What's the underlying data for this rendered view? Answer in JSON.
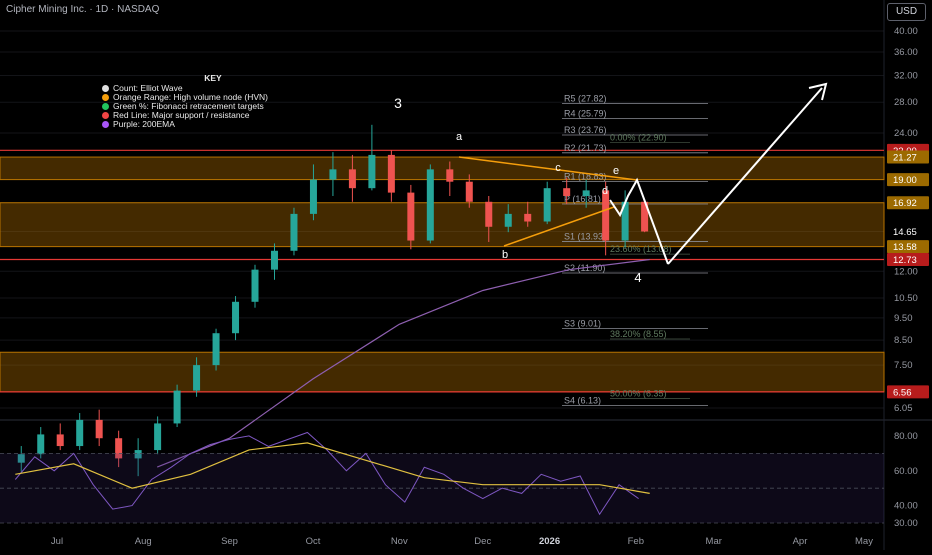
{
  "header": {
    "title": "Cipher Mining Inc. · 1D · NASDAQ",
    "currency": "USD"
  },
  "key": {
    "title": "KEY",
    "items": [
      {
        "label": "Count: Elliot Wave",
        "color": "#e0e0e0"
      },
      {
        "label": "Orange Range: High volume node (HVN)",
        "color": "#f59e0b"
      },
      {
        "label": "Green %: Fibonacci retracement targets",
        "color": "#22c55e"
      },
      {
        "label": "Red Line: Major support / resistance",
        "color": "#ef4444"
      },
      {
        "label": "Purple: 200EMA",
        "color": "#a855f7"
      }
    ]
  },
  "chart_data": [
    {
      "type": "candlestick",
      "y_scale": "log",
      "price_axis_ticks": [
        40.0,
        36.0,
        32.0,
        28.0,
        24.0,
        19.0,
        16.92,
        14.65,
        12.0,
        10.5,
        9.5,
        8.5,
        7.5,
        6.05
      ],
      "price_badges": [
        {
          "value": "22.00",
          "bg": "#b71c1c"
        },
        {
          "value": "21.27",
          "bg": "#9c6a00"
        },
        {
          "value": "19.00",
          "bg": "#9c6a00"
        },
        {
          "value": "16.92",
          "bg": "#9c6a00"
        },
        {
          "value": "14.65",
          "bg": "#000000"
        },
        {
          "value": "13.58",
          "bg": "#9c6a00"
        },
        {
          "value": "12.73",
          "bg": "#b71c1c"
        },
        {
          "value": "6.56",
          "bg": "#b71c1c"
        }
      ],
      "x_axis_labels": [
        "Jul",
        "Aug",
        "Sep",
        "Oct",
        "Nov",
        "Dec",
        "2026",
        "Feb",
        "Mar",
        "Apr",
        "May"
      ],
      "hvn_zones": [
        [
          19.0,
          21.27
        ],
        [
          13.58,
          16.92
        ],
        [
          6.56,
          8.0
        ]
      ],
      "support_resistance_lines": [
        22.0,
        12.73,
        6.56
      ],
      "pivot_levels": [
        {
          "label": "R5 (27.82)",
          "value": 27.82
        },
        {
          "label": "R4 (25.79)",
          "value": 25.79
        },
        {
          "label": "R3 (23.76)",
          "value": 23.76
        },
        {
          "label": "R2 (21.73)",
          "value": 21.73
        },
        {
          "label": "R1 (18.83)",
          "value": 18.83
        },
        {
          "label": "P (16.81)",
          "value": 16.81
        },
        {
          "label": "S1 (13.93)",
          "value": 13.93
        },
        {
          "label": "S2 (11.90)",
          "value": 11.9
        },
        {
          "label": "S3 (9.01)",
          "value": 9.01
        },
        {
          "label": "S4 (6.13)",
          "value": 6.13
        }
      ],
      "fib_levels": [
        {
          "label": "0.00% (22.90)",
          "value": 22.9
        },
        {
          "label": "23.60% (13.08)",
          "value": 13.08
        },
        {
          "label": "38.20% (8.55)",
          "value": 8.55
        },
        {
          "label": "50.00% (6.35)",
          "value": 6.35
        }
      ],
      "wave_labels": [
        "3",
        "a",
        "b",
        "c",
        "d",
        "e",
        "4"
      ],
      "ohlc": [
        {
          "date": "2025-06-30",
          "o": 4.6,
          "h": 5.0,
          "l": 4.4,
          "c": 4.8
        },
        {
          "date": "2025-07-07",
          "o": 4.8,
          "h": 5.5,
          "l": 4.7,
          "c": 5.3
        },
        {
          "date": "2025-07-14",
          "o": 5.3,
          "h": 5.6,
          "l": 4.9,
          "c": 5.0
        },
        {
          "date": "2025-07-21",
          "o": 5.0,
          "h": 5.9,
          "l": 4.9,
          "c": 5.7
        },
        {
          "date": "2025-07-28",
          "o": 5.7,
          "h": 6.0,
          "l": 5.0,
          "c": 5.2
        },
        {
          "date": "2025-08-04",
          "o": 5.2,
          "h": 5.4,
          "l": 4.5,
          "c": 4.7
        },
        {
          "date": "2025-08-11",
          "o": 4.7,
          "h": 5.2,
          "l": 4.3,
          "c": 4.9
        },
        {
          "date": "2025-08-18",
          "o": 4.9,
          "h": 5.8,
          "l": 4.8,
          "c": 5.6
        },
        {
          "date": "2025-08-25",
          "o": 5.6,
          "h": 6.8,
          "l": 5.5,
          "c": 6.6
        },
        {
          "date": "2025-09-01",
          "o": 6.6,
          "h": 7.8,
          "l": 6.4,
          "c": 7.5
        },
        {
          "date": "2025-09-08",
          "o": 7.5,
          "h": 9.0,
          "l": 7.3,
          "c": 8.8
        },
        {
          "date": "2025-09-15",
          "o": 8.8,
          "h": 10.6,
          "l": 8.5,
          "c": 10.3
        },
        {
          "date": "2025-09-22",
          "o": 10.3,
          "h": 12.4,
          "l": 10.0,
          "c": 12.1
        },
        {
          "date": "2025-09-29",
          "o": 12.1,
          "h": 13.8,
          "l": 11.5,
          "c": 13.3
        },
        {
          "date": "2025-10-06",
          "o": 13.3,
          "h": 16.5,
          "l": 13.0,
          "c": 16.0
        },
        {
          "date": "2025-10-13",
          "o": 16.0,
          "h": 20.5,
          "l": 15.5,
          "c": 19.0
        },
        {
          "date": "2025-10-20",
          "o": 19.0,
          "h": 21.8,
          "l": 17.5,
          "c": 20.0
        },
        {
          "date": "2025-10-27",
          "o": 20.0,
          "h": 21.5,
          "l": 17.0,
          "c": 18.2
        },
        {
          "date": "2025-11-03",
          "o": 18.2,
          "h": 25.0,
          "l": 18.0,
          "c": 21.5
        },
        {
          "date": "2025-11-10",
          "o": 21.5,
          "h": 22.0,
          "l": 17.0,
          "c": 17.8
        },
        {
          "date": "2025-11-17",
          "o": 17.8,
          "h": 18.5,
          "l": 13.4,
          "c": 14.0
        },
        {
          "date": "2025-11-24",
          "o": 14.0,
          "h": 20.5,
          "l": 13.8,
          "c": 20.0
        },
        {
          "date": "2025-12-01",
          "o": 20.0,
          "h": 20.8,
          "l": 17.5,
          "c": 18.8
        },
        {
          "date": "2025-12-08",
          "o": 18.8,
          "h": 19.5,
          "l": 16.5,
          "c": 17.0
        },
        {
          "date": "2025-12-15",
          "o": 17.0,
          "h": 17.5,
          "l": 13.9,
          "c": 15.0
        },
        {
          "date": "2025-12-22",
          "o": 15.0,
          "h": 16.8,
          "l": 14.6,
          "c": 16.0
        },
        {
          "date": "2025-12-29",
          "o": 16.0,
          "h": 17.0,
          "l": 15.0,
          "c": 15.4
        },
        {
          "date": "2026-01-05",
          "o": 15.4,
          "h": 18.8,
          "l": 15.2,
          "c": 18.2
        },
        {
          "date": "2026-01-12",
          "o": 18.2,
          "h": 19.2,
          "l": 16.8,
          "c": 17.5
        },
        {
          "date": "2026-01-19",
          "o": 17.5,
          "h": 19.0,
          "l": 16.5,
          "c": 18.0
        },
        {
          "date": "2026-01-26",
          "o": 18.0,
          "h": 18.8,
          "l": 13.0,
          "c": 14.0
        },
        {
          "date": "2026-02-02",
          "o": 14.0,
          "h": 18.0,
          "l": 13.5,
          "c": 17.0
        },
        {
          "date": "2026-02-09",
          "o": 17.0,
          "h": 17.2,
          "l": 14.6,
          "c": 14.65
        }
      ],
      "ema200": [
        {
          "date": "2025-08-20",
          "value": 4.5
        },
        {
          "date": "2025-09-15",
          "value": 5.2
        },
        {
          "date": "2025-10-15",
          "value": 7.0
        },
        {
          "date": "2025-11-15",
          "value": 9.2
        },
        {
          "date": "2025-12-15",
          "value": 10.9
        },
        {
          "date": "2026-01-15",
          "value": 12.1
        },
        {
          "date": "2026-02-13",
          "value": 12.73
        }
      ]
    },
    {
      "type": "line",
      "indicator": "oscillator",
      "y_ticks": [
        80.0,
        60.0,
        40.0,
        30.0
      ],
      "ylim": [
        26,
        88
      ],
      "series": [
        {
          "values": [
            {
              "date": "2025-06-30",
              "value": 55
            },
            {
              "date": "2025-07-07",
              "value": 68
            },
            {
              "date": "2025-07-14",
              "value": 60
            },
            {
              "date": "2025-07-21",
              "value": 70
            },
            {
              "date": "2025-07-28",
              "value": 52
            },
            {
              "date": "2025-08-04",
              "value": 38
            },
            {
              "date": "2025-08-11",
              "value": 40
            },
            {
              "date": "2025-08-18",
              "value": 55
            },
            {
              "date": "2025-08-25",
              "value": 62
            },
            {
              "date": "2025-09-01",
              "value": 70
            },
            {
              "date": "2025-09-08",
              "value": 75
            },
            {
              "date": "2025-09-15",
              "value": 78
            },
            {
              "date": "2025-09-22",
              "value": 80
            },
            {
              "date": "2025-09-29",
              "value": 74
            },
            {
              "date": "2025-10-06",
              "value": 78
            },
            {
              "date": "2025-10-13",
              "value": 82
            },
            {
              "date": "2025-10-20",
              "value": 72
            },
            {
              "date": "2025-10-27",
              "value": 60
            },
            {
              "date": "2025-11-03",
              "value": 70
            },
            {
              "date": "2025-11-10",
              "value": 52
            },
            {
              "date": "2025-11-17",
              "value": 42
            },
            {
              "date": "2025-11-24",
              "value": 62
            },
            {
              "date": "2025-12-01",
              "value": 58
            },
            {
              "date": "2025-12-08",
              "value": 50
            },
            {
              "date": "2025-12-15",
              "value": 44
            },
            {
              "date": "2025-12-22",
              "value": 50
            },
            {
              "date": "2025-12-29",
              "value": 47
            },
            {
              "date": "2026-01-05",
              "value": 58
            },
            {
              "date": "2026-01-12",
              "value": 54
            },
            {
              "date": "2026-01-19",
              "value": 57
            },
            {
              "date": "2026-01-26",
              "value": 35
            },
            {
              "date": "2026-02-02",
              "value": 52
            },
            {
              "date": "2026-02-09",
              "value": 44
            }
          ]
        },
        {
          "values": [
            {
              "date": "2025-06-30",
              "value": 58
            },
            {
              "date": "2025-07-21",
              "value": 64
            },
            {
              "date": "2025-08-11",
              "value": 50
            },
            {
              "date": "2025-09-01",
              "value": 58
            },
            {
              "date": "2025-09-22",
              "value": 72
            },
            {
              "date": "2025-10-13",
              "value": 76
            },
            {
              "date": "2025-11-03",
              "value": 66
            },
            {
              "date": "2025-11-24",
              "value": 56
            },
            {
              "date": "2025-12-15",
              "value": 52
            },
            {
              "date": "2026-01-05",
              "value": 52
            },
            {
              "date": "2026-01-26",
              "value": 52
            },
            {
              "date": "2026-02-13",
              "value": 47
            }
          ]
        }
      ]
    }
  ]
}
